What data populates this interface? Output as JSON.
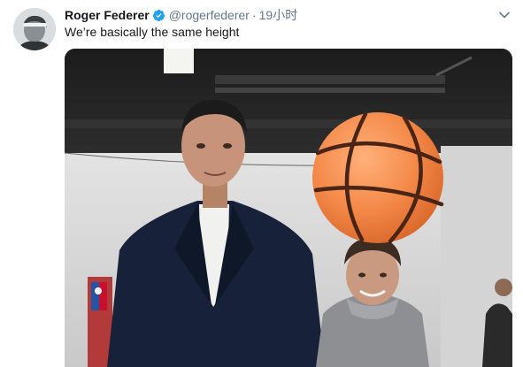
{
  "tweet": {
    "display_name": "Roger Federer",
    "handle": "@rogerfederer",
    "separator": "·",
    "time": "19小时",
    "text": "We’re basically the same height",
    "icons": {
      "verified": "verified-badge-icon",
      "caret": "chevron-down-icon"
    },
    "colors": {
      "link_blue": "#1da1f2",
      "secondary_text": "#657786",
      "primary_text": "#14171a"
    }
  }
}
